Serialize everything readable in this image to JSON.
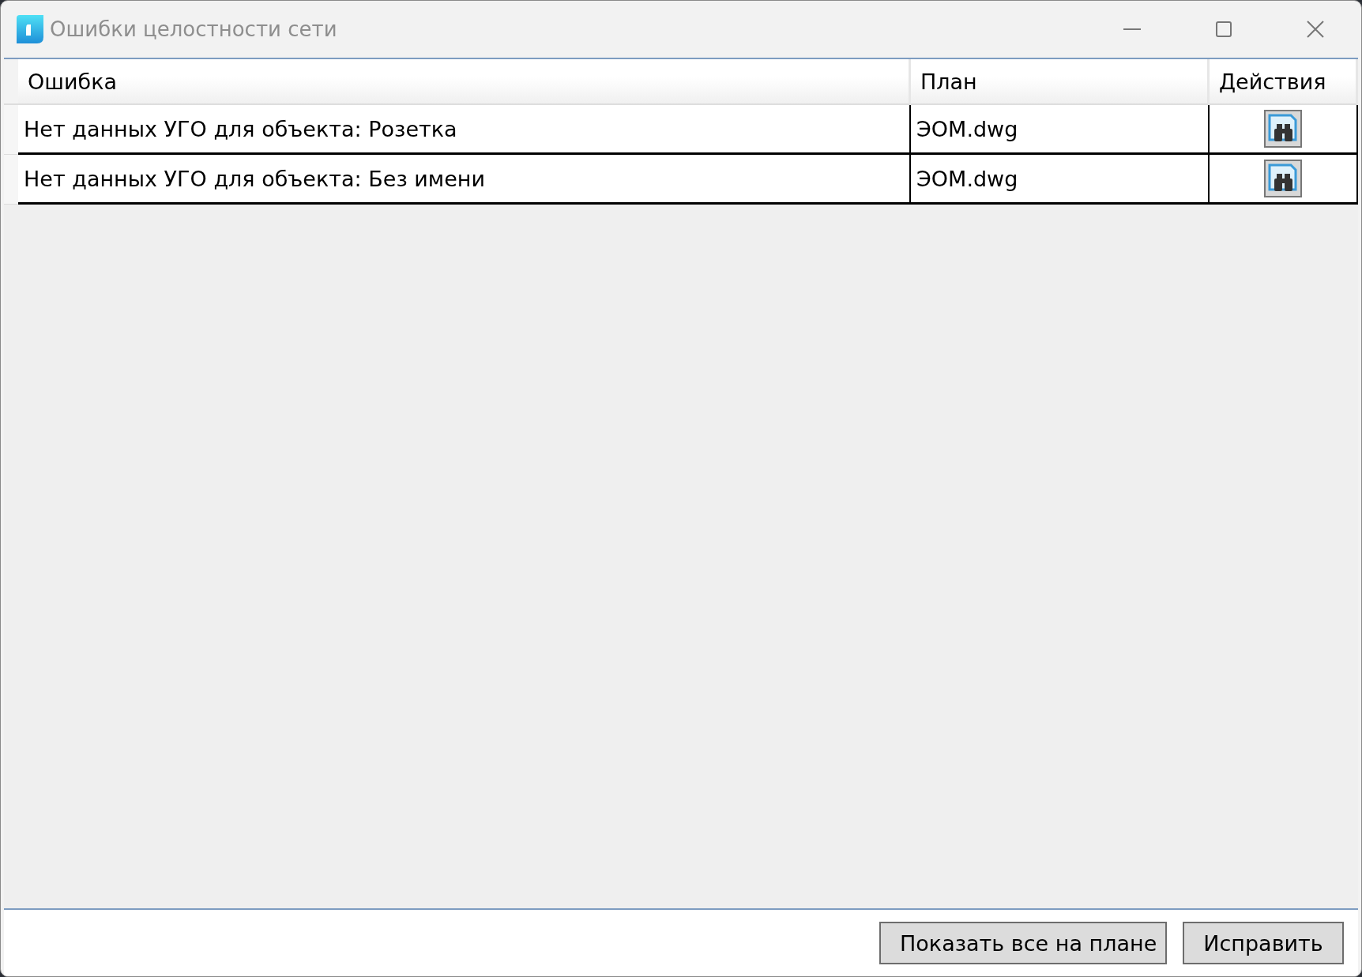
{
  "window": {
    "title": "Ошибки целостности сети"
  },
  "table": {
    "columns": [
      "Ошибка",
      "План",
      "Действия"
    ],
    "rows": [
      {
        "error": "Нет данных УГО для объекта: Розетка",
        "plan": "ЭОМ.dwg"
      },
      {
        "error": "Нет данных УГО для объекта: Без имени",
        "plan": "ЭОМ.dwg"
      }
    ]
  },
  "buttons": [
    "Показать все на плане",
    "Исправить"
  ]
}
